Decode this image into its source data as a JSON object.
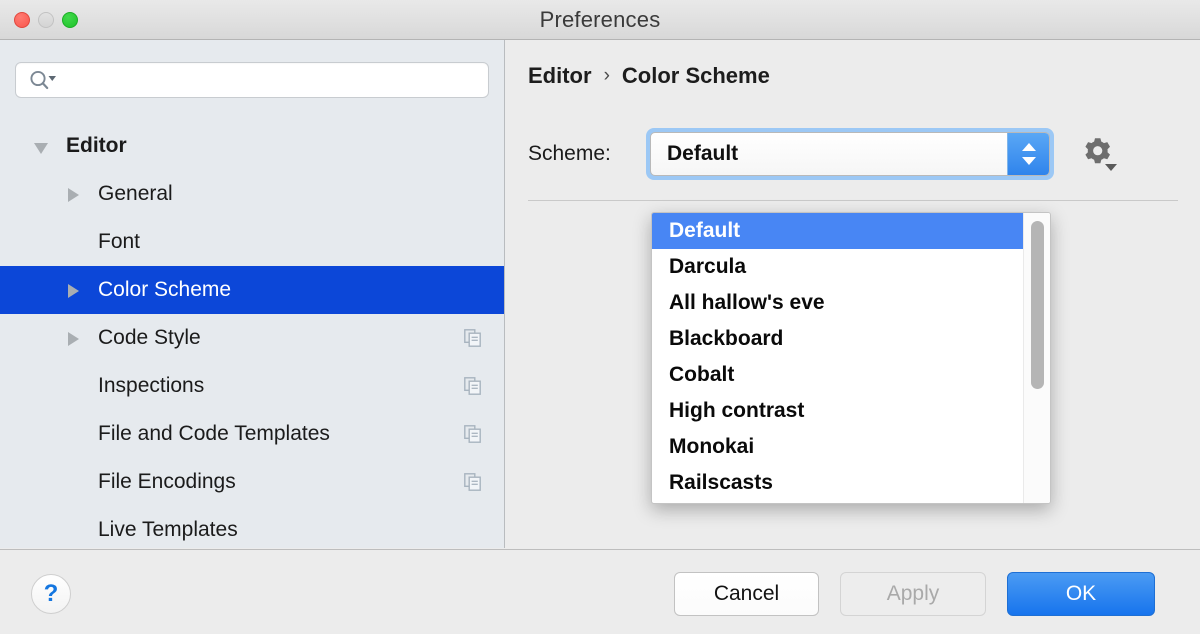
{
  "window": {
    "title": "Preferences",
    "traffic_lights": [
      "close",
      "minimize",
      "zoom"
    ]
  },
  "search": {
    "placeholder": "",
    "value": "",
    "icon": "search-icon"
  },
  "sidebar": {
    "items": [
      {
        "label": "Editor",
        "indent": 0,
        "twisty": "down",
        "bold": true,
        "selected": false,
        "copy_icon": false
      },
      {
        "label": "General",
        "indent": 1,
        "twisty": "right",
        "bold": false,
        "selected": false,
        "copy_icon": false
      },
      {
        "label": "Font",
        "indent": 1,
        "twisty": "none",
        "bold": false,
        "selected": false,
        "copy_icon": false
      },
      {
        "label": "Color Scheme",
        "indent": 1,
        "twisty": "right",
        "bold": false,
        "selected": true,
        "copy_icon": false
      },
      {
        "label": "Code Style",
        "indent": 1,
        "twisty": "right",
        "bold": false,
        "selected": false,
        "copy_icon": true
      },
      {
        "label": "Inspections",
        "indent": 1,
        "twisty": "none",
        "bold": false,
        "selected": false,
        "copy_icon": true
      },
      {
        "label": "File and Code Templates",
        "indent": 1,
        "twisty": "none",
        "bold": false,
        "selected": false,
        "copy_icon": true
      },
      {
        "label": "File Encodings",
        "indent": 1,
        "twisty": "none",
        "bold": false,
        "selected": false,
        "copy_icon": true
      },
      {
        "label": "Live Templates",
        "indent": 1,
        "twisty": "none",
        "bold": false,
        "selected": false,
        "copy_icon": false
      }
    ]
  },
  "pane": {
    "breadcrumb": {
      "root": "Editor",
      "separator": "›",
      "leaf": "Color Scheme"
    },
    "scheme": {
      "label": "Scheme:",
      "selected": "Default",
      "gear_icon": "gear-icon",
      "options": [
        "Default",
        "Darcula",
        "All hallow's eve",
        "Blackboard",
        "Cobalt",
        "High contrast",
        "Monokai",
        "Railscasts"
      ],
      "highlighted_option": "Default"
    }
  },
  "footer": {
    "help": "?",
    "cancel": "Cancel",
    "apply": "Apply",
    "ok": "OK"
  },
  "colors": {
    "selection_blue": "#0c47d8",
    "menu_highlight_blue": "#4886f4",
    "ok_button_blue": "#1774ed",
    "sidebar_bg": "#e6eaee",
    "pane_bg": "#ececec"
  }
}
